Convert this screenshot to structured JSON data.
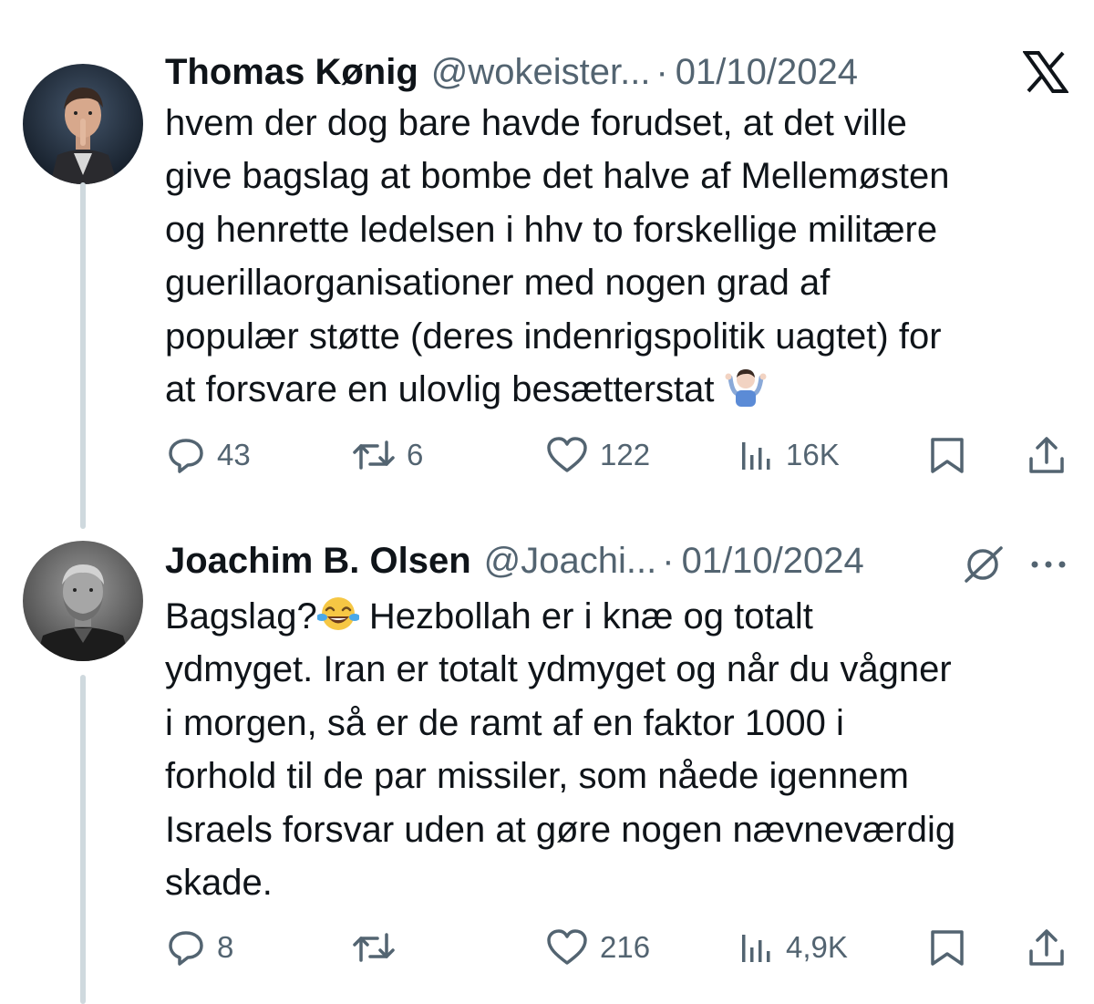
{
  "tweets": [
    {
      "author": "Thomas Kønig",
      "handle": "@wokeister...",
      "separator": "·",
      "date": "01/10/2024",
      "text_lines": [
        "hvem der dog bare havde forudset, at det ville",
        "give bagslag at bombe det halve af Mellemøsten",
        "og henrette ledelsen i hhv to forskellige militære",
        "guerillaorganisationer med nogen grad af",
        "populær støtte (deres indenrigspolitik uagtet) for",
        "at forsvare en ulovlig besætterstat"
      ],
      "trailing_emoji": "person-shrugging",
      "stats": {
        "replies": "43",
        "retweets": "6",
        "likes": "122",
        "views": "16K"
      },
      "top_right_icon": "x-logo"
    },
    {
      "author": "Joachim B. Olsen",
      "handle": "@Joachi...",
      "separator": "·",
      "date": "01/10/2024",
      "text_lines": [
        "Bagslag?",
        " Hezbollah er i knæ og totalt",
        "ydmyget. Iran er totalt ydmyget og når du vågner",
        "i morgen, så er de ramt af en faktor 1000 i",
        "forhold til de par missiler, som nåede igennem",
        "Israels forsvar uden at gøre nogen nævneværdig",
        "skade."
      ],
      "inline_emoji": "face-with-tears-of-joy",
      "stats": {
        "replies": "8",
        "retweets": "",
        "likes": "216",
        "views": "4,9K"
      },
      "top_right_icons": [
        "grok-icon",
        "more-icon"
      ]
    }
  ],
  "colors": {
    "text": "#0f1419",
    "secondary": "#536471",
    "thread_line": "#cfd9de"
  }
}
